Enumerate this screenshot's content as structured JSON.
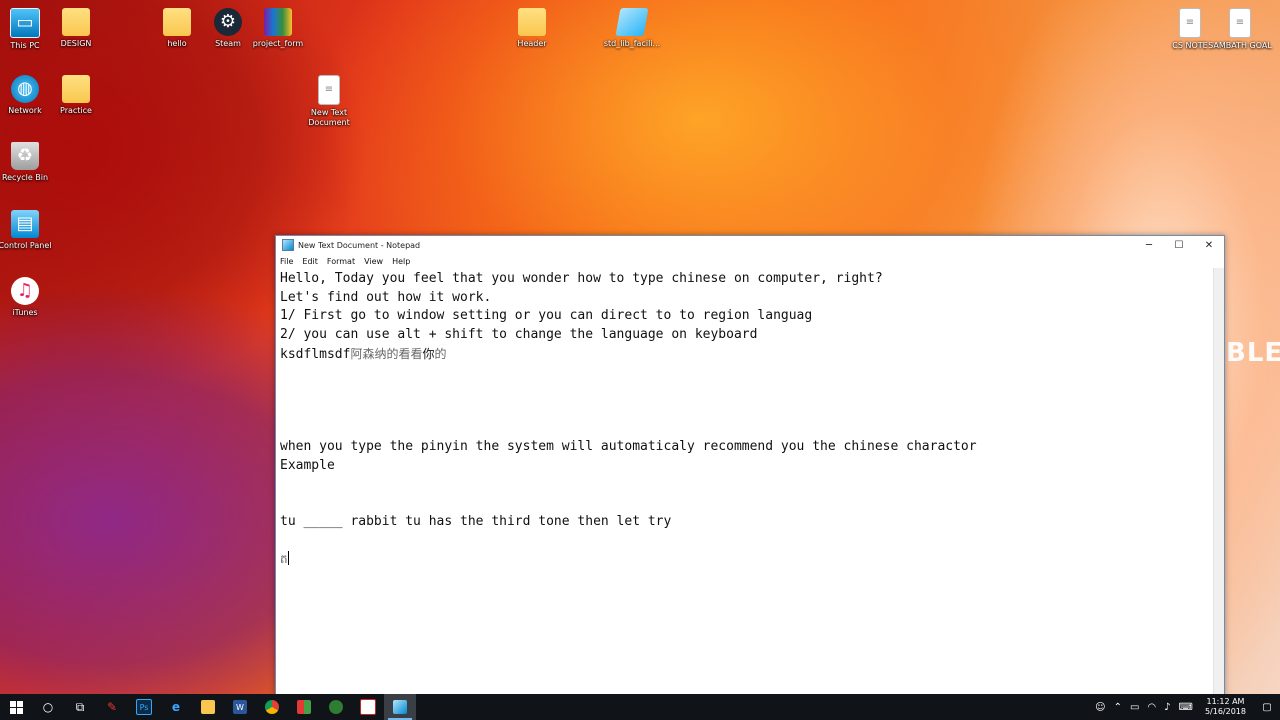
{
  "desktop": {
    "icons_left": [
      {
        "label": "This PC",
        "icon": "this-pc-icon"
      },
      {
        "label": "Network",
        "icon": "network-icon"
      },
      {
        "label": "Recycle Bin",
        "icon": "recycle-bin-icon"
      },
      {
        "label": "Control Panel",
        "icon": "control-panel-icon"
      },
      {
        "label": "iTunes",
        "icon": "itunes-icon"
      }
    ],
    "icons_col2": [
      {
        "label": "DESIGN",
        "icon": "folder-icon"
      },
      {
        "label": "Practice",
        "icon": "folder-icon"
      }
    ],
    "icons_top": [
      {
        "label": "hello",
        "icon": "folder-icon"
      },
      {
        "label": "Steam",
        "icon": "steam-icon"
      },
      {
        "label": "project_form",
        "icon": "winrar-icon"
      },
      {
        "label": "New Text Document",
        "icon": "text-document-icon"
      },
      {
        "label": "Header",
        "icon": "folder-icon"
      },
      {
        "label": "std_lib_facili...",
        "icon": "notepad-file-icon"
      }
    ],
    "icons_right": [
      {
        "label": "CS NOTE",
        "icon": "document-icon"
      },
      {
        "label": "SAMBATH GOAL",
        "icon": "document-icon"
      }
    ],
    "wallpaper_text": "BLE"
  },
  "notepad": {
    "title": "New Text Document - Notepad",
    "controls": {
      "minimize": "─",
      "maximize": "☐",
      "close": "✕"
    },
    "menu": [
      "File",
      "Edit",
      "Format",
      "View",
      "Help"
    ],
    "lines": [
      "Hello, Today you feel that you wonder how to type chinese on computer, right?",
      "Let's find out how it work.",
      "1/ First go to window setting or you can direct to to region languag",
      "2/ you can use alt + shift to change the language on keyboard"
    ],
    "line5_latin": "ksdflmsdf",
    "line5_cjk_a": "阿森纳的看看",
    "line5_cjk_b": "你",
    "line5_cjk_c": "的",
    "lines_b": [
      "when you type the pinyin the system will automaticaly recommend you the chinese charactor",
      "Example"
    ],
    "line_tu": "tu _____ rabbit tu has the third tone then let try",
    "line_last": "ត"
  },
  "taskbar": {
    "start_icon": "windows-start-icon",
    "apps": [
      "search-icon",
      "task-view-icon",
      "pen-app-icon",
      "photoshop-icon",
      "edge-icon",
      "file-explorer-icon",
      "word-icon",
      "chrome-icon",
      "colorful-app-icon",
      "green-app-icon",
      "media-app-icon",
      "notepad-icon"
    ],
    "ps_label": "Ps",
    "word_label": "W",
    "time": "11:12 AM",
    "date": "5/16/2018"
  },
  "colors": {
    "taskbar_bg": "#101318",
    "taskbar_active_underline": "#76b9ed",
    "window_border": "#6a8db5"
  }
}
